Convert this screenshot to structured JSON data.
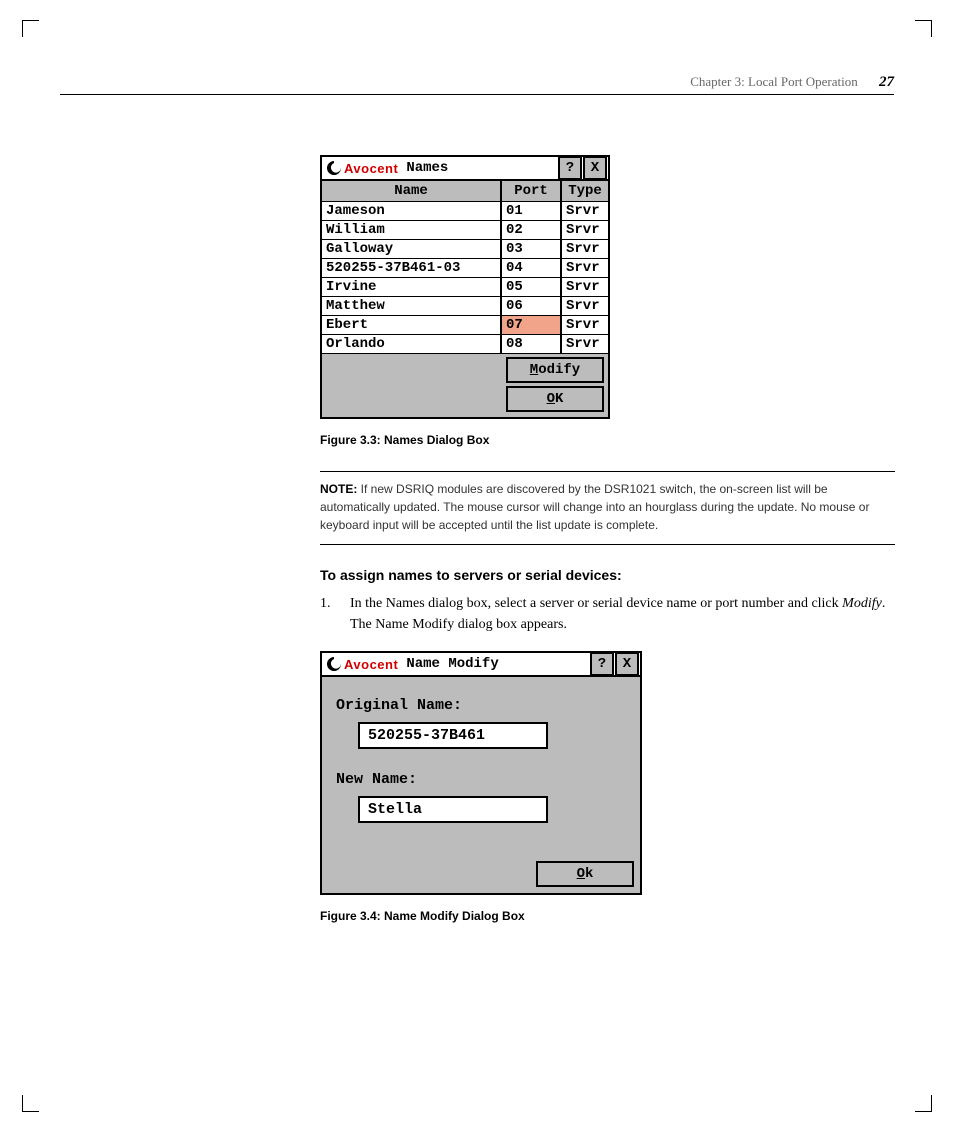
{
  "header": {
    "chapter": "Chapter 3: Local Port Operation",
    "page": "27"
  },
  "brand": "Avocent",
  "dialog1": {
    "title": "Names",
    "help": "?",
    "close": "X",
    "cols": {
      "name": "Name",
      "port": "Port",
      "type": "Type"
    },
    "rows": [
      {
        "name": "Jameson",
        "port": "01",
        "type": "Srvr"
      },
      {
        "name": "William",
        "port": "02",
        "type": "Srvr"
      },
      {
        "name": "Galloway",
        "port": "03",
        "type": "Srvr"
      },
      {
        "name": "520255-37B461-03",
        "port": "04",
        "type": "Srvr"
      },
      {
        "name": "Irvine",
        "port": "05",
        "type": "Srvr"
      },
      {
        "name": "Matthew",
        "port": "06",
        "type": "Srvr"
      },
      {
        "name": "Ebert",
        "port": "07",
        "type": "Srvr",
        "sel": true
      },
      {
        "name": "Orlando",
        "port": "08",
        "type": "Srvr"
      }
    ],
    "modify_u": "M",
    "modify_rest": "odify",
    "ok_u": "O",
    "ok_rest": "K"
  },
  "fig1": "Figure 3.3: Names Dialog Box",
  "note": {
    "label": "NOTE:",
    "text": " If new DSRIQ modules are discovered by the DSR1021 switch, the on-screen list will be automatically updated. The mouse cursor will change into an hourglass during the update. No mouse or keyboard input will be accepted until the list update is complete."
  },
  "section": "To assign names to servers or serial devices:",
  "step1": {
    "num": "1.",
    "pre": "In the Names dialog box, select a server or serial device name or port number and click ",
    "em": "Modify",
    "post": ". The Name Modify dialog box appears."
  },
  "dialog2": {
    "title": "Name Modify",
    "help": "?",
    "close": "X",
    "orig_label": "Original Name:",
    "orig_value": "520255-37B461",
    "new_label": "New Name:",
    "new_value": "Stella",
    "ok_u": "O",
    "ok_rest": "k"
  },
  "fig2": "Figure 3.4: Name Modify Dialog Box"
}
